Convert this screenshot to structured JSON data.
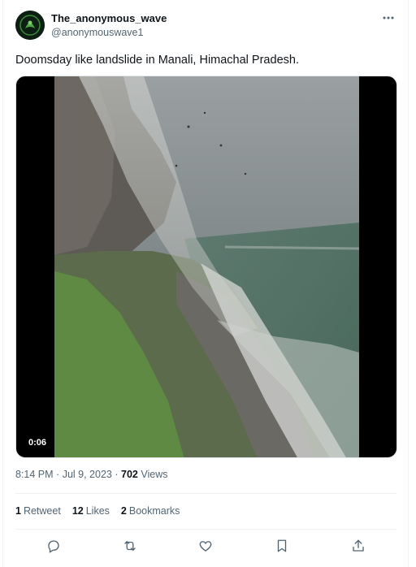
{
  "author": {
    "display_name": "The_anonymous_wave",
    "handle": "@anonymouswave1",
    "avatar_icon": "green-emblem-avatar"
  },
  "tweet": {
    "text": "Doomsday like landslide in Manali, Himachal Pradesh.",
    "video_duration": "0:06",
    "time": "8:14 PM",
    "separator": "·",
    "date": "Jul 9, 2023",
    "views_count": "702",
    "views_label": "Views"
  },
  "stats": {
    "retweets_count": "1",
    "retweets_label": "Retweet",
    "likes_count": "12",
    "likes_label": "Likes",
    "bookmarks_count": "2",
    "bookmarks_label": "Bookmarks"
  },
  "actions": [
    {
      "icon": "reply-icon"
    },
    {
      "icon": "retweet-icon"
    },
    {
      "icon": "like-icon"
    },
    {
      "icon": "bookmark-icon"
    },
    {
      "icon": "share-icon"
    }
  ],
  "colors": {
    "text_primary": "#0f1419",
    "text_secondary": "#536471",
    "divider": "#eff3f4"
  }
}
